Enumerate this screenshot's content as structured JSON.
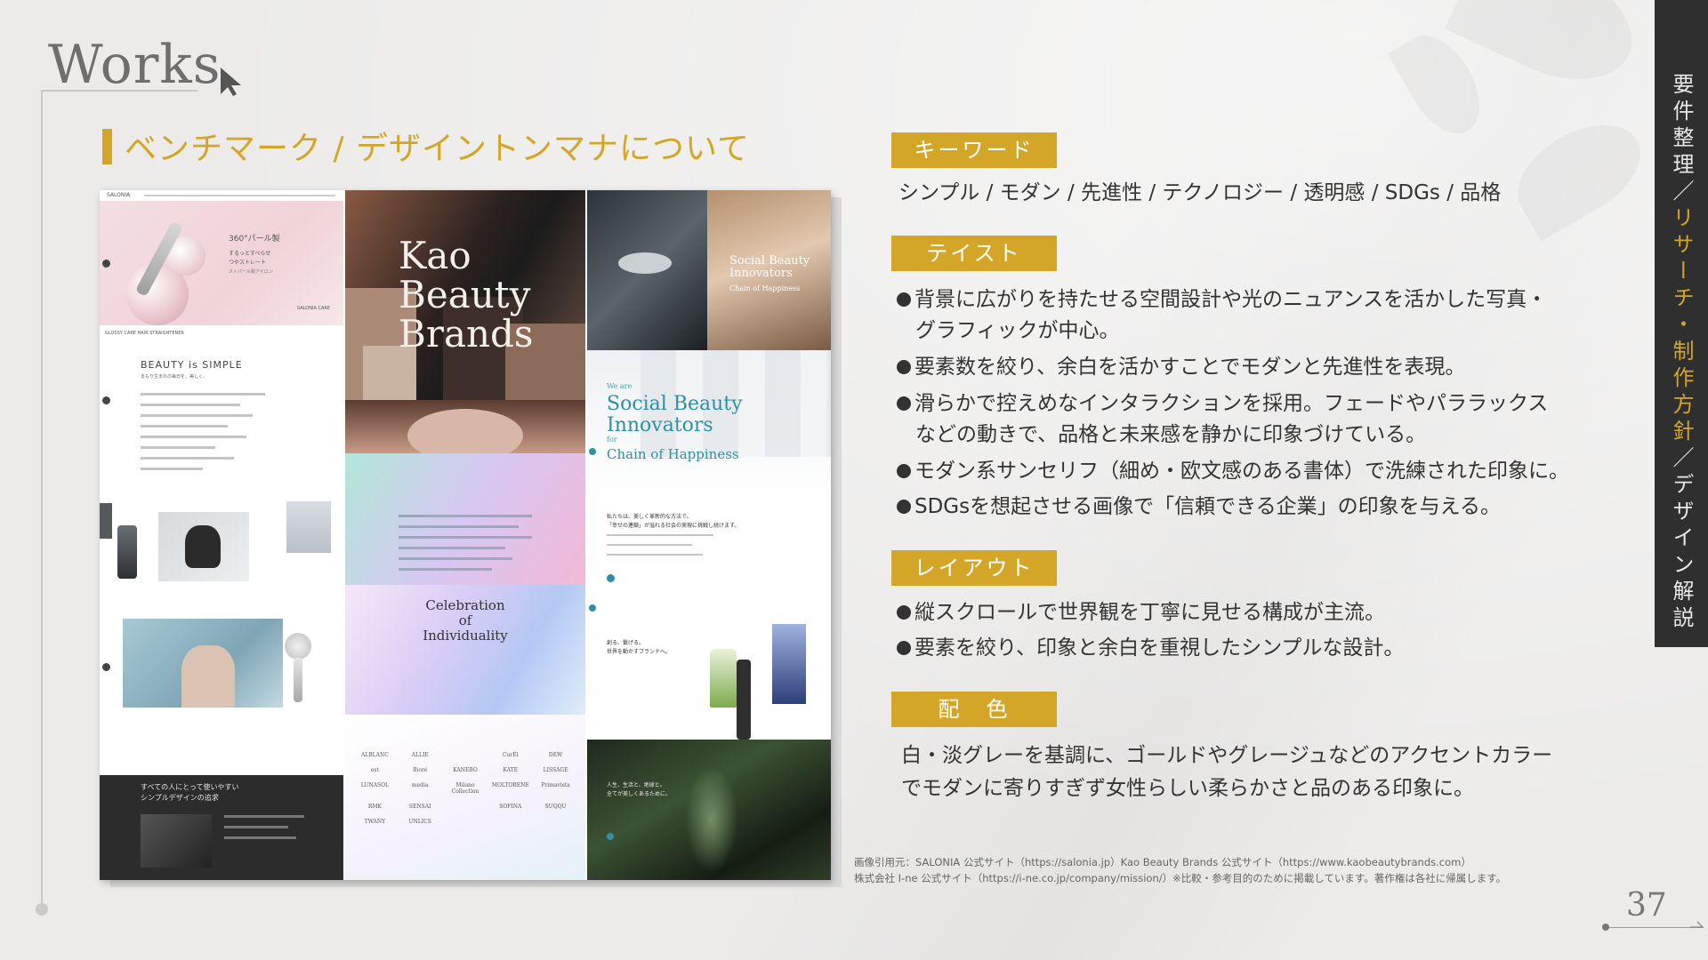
{
  "header": {
    "title": "Works",
    "section_title": "ベンチマーク / デザイントンマナについて"
  },
  "collage": {
    "salonia": {
      "hero_line1": "360°パール製",
      "hero_line2": "するっとすべらせ",
      "hero_line3": "つやストレート",
      "hero_line4": "ストパール製アイロン",
      "hero_badge": "SALONIA CARE",
      "bar_text": "GLOSSY CARE HAIR STRAIGHTENER",
      "heading": "BEAUTY is SIMPLE",
      "subheading": "まもり生まれの毎日を、美しく。",
      "dark_line1": "すべての人にとって使いやすい",
      "dark_line2": "シンプルデザインの追求"
    },
    "kao": {
      "logo_line1": "Kao",
      "logo_line2": "Beauty",
      "logo_line3": "Brands",
      "celebration_line1": "Celebration",
      "celebration_line2": "of",
      "celebration_line3": "Individuality",
      "brands": [
        "ALBLANC",
        "ALLIE",
        "",
        "CurÉl",
        "DEW",
        "est",
        "Bioré",
        "KANEBO",
        "KATE",
        "LISSAGE",
        "LUNASOL",
        "media",
        "Milano Collection",
        "MOLTOBENE",
        "Primavista",
        "RMK",
        "SENSAI",
        "",
        "SOFINA",
        "SUQQU",
        "TWANY",
        "UNLICS"
      ]
    },
    "ine": {
      "hero_line1": "Social Beauty",
      "hero_line2": "Innovators",
      "hero_line3": "Chain of Happiness",
      "we_are": "We are",
      "big_line1": "Social Beauty",
      "big_line2": "Innovators",
      "for": "for",
      "big_line3": "Chain of Happiness",
      "jp_line1": "私たちは、美しく革新的な方法で、",
      "jp_line2": "「幸せの連鎖」が溢れる社会の実現に挑戦し続けます。",
      "sec2_line1": "創る、繋げる。",
      "sec2_line2": "世界を動かすブランドへ。",
      "sec3_line1": "人生、生活と、地球と。",
      "sec3_line2": "全てが美しくあるために。"
    }
  },
  "sections": [
    {
      "label": "キーワード",
      "text": "シンプル / モダン / 先進性 / テクノロジー / 透明感 / SDGs / 品格"
    },
    {
      "label": "テイスト",
      "bullets": [
        "背景に広がりを持たせる空間設計や光のニュアンスを活かした写真・",
        "グラフィックが中心。",
        "要素数を絞り、余白を活かすことでモダンと先進性を表現。",
        "滑らかで控えめなインタラクションを採用。フェードやパララックス",
        "などの動きで、品格と未来感を静かに印象づけている。",
        "モダン系サンセリフ（細め・欧文感のある書体）で洗練された印象に。",
        "SDGsを想起させる画像で「信頼できる企業」の印象を与える。"
      ]
    },
    {
      "label": "レイアウト",
      "bullets": [
        "縦スクロールで世界観を丁寧に見せる構成が主流。",
        "要素を絞り、印象と余白を重視したシンプルな設計。"
      ]
    },
    {
      "label": "配　色",
      "lines": [
        "白・淡グレーを基調に、ゴールドやグレージュなどのアクセントカラー",
        "でモダンに寄りすぎず女性らしい柔らかさと品のある印象に。"
      ]
    }
  ],
  "credit": {
    "line1": "画像引用元：SALONIA 公式サイト（https://salonia.jp）Kao Beauty Brands 公式サイト（https://www.kaobeautybrands.com）",
    "line2": "株式会社 I-ne 公式サイト（https://i-ne.co.jp/company/mission/）※比較・参考目的のために掲載しています。著作権は各社に帰属します。"
  },
  "sidebar": {
    "part1": "要件整理",
    "sep1": "／",
    "part2": "リサーチ・制作方針",
    "sep2": "／",
    "part3": "デザイン解説"
  },
  "page_number": "37",
  "colors": {
    "accent": "#d4a627",
    "sidebar": "#2f2f2f",
    "background": "#ecebea"
  }
}
